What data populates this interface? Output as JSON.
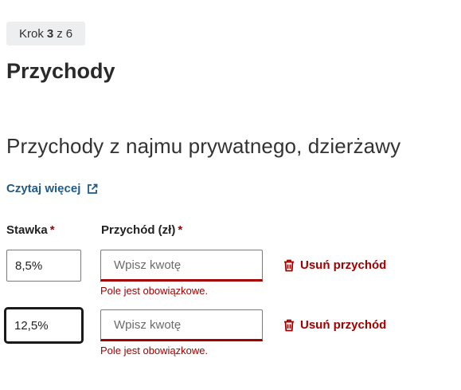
{
  "step": {
    "prefix": "Krok",
    "current": "3",
    "of_word": "z",
    "total": "6"
  },
  "page_title": "Przychody",
  "section_title": "Przychody z najmu prywatnego, dzierżawy",
  "read_more": {
    "label": "Czytaj więcej",
    "icon": "external-link-icon"
  },
  "columns": {
    "rate_label": "Stawka",
    "income_label": "Przychód (zł)",
    "required_mark": "*"
  },
  "rows": [
    {
      "rate_value": "8,5%",
      "income_value": "",
      "income_placeholder": "Wpisz kwotę",
      "delete_label": "Usuń przychód",
      "error": "Pole jest obowiązkowe.",
      "focused": false
    },
    {
      "rate_value": "12,5%",
      "income_value": "",
      "income_placeholder": "Wpisz kwotę",
      "delete_label": "Usuń przychód",
      "error": "Pole jest obowiązkowe.",
      "focused": true
    }
  ],
  "colors": {
    "link": "#1f5a8c",
    "error": "#a40000",
    "badge_bg": "#eceef0"
  },
  "icons": {
    "delete": "trash-icon",
    "external": "external-link-icon"
  }
}
